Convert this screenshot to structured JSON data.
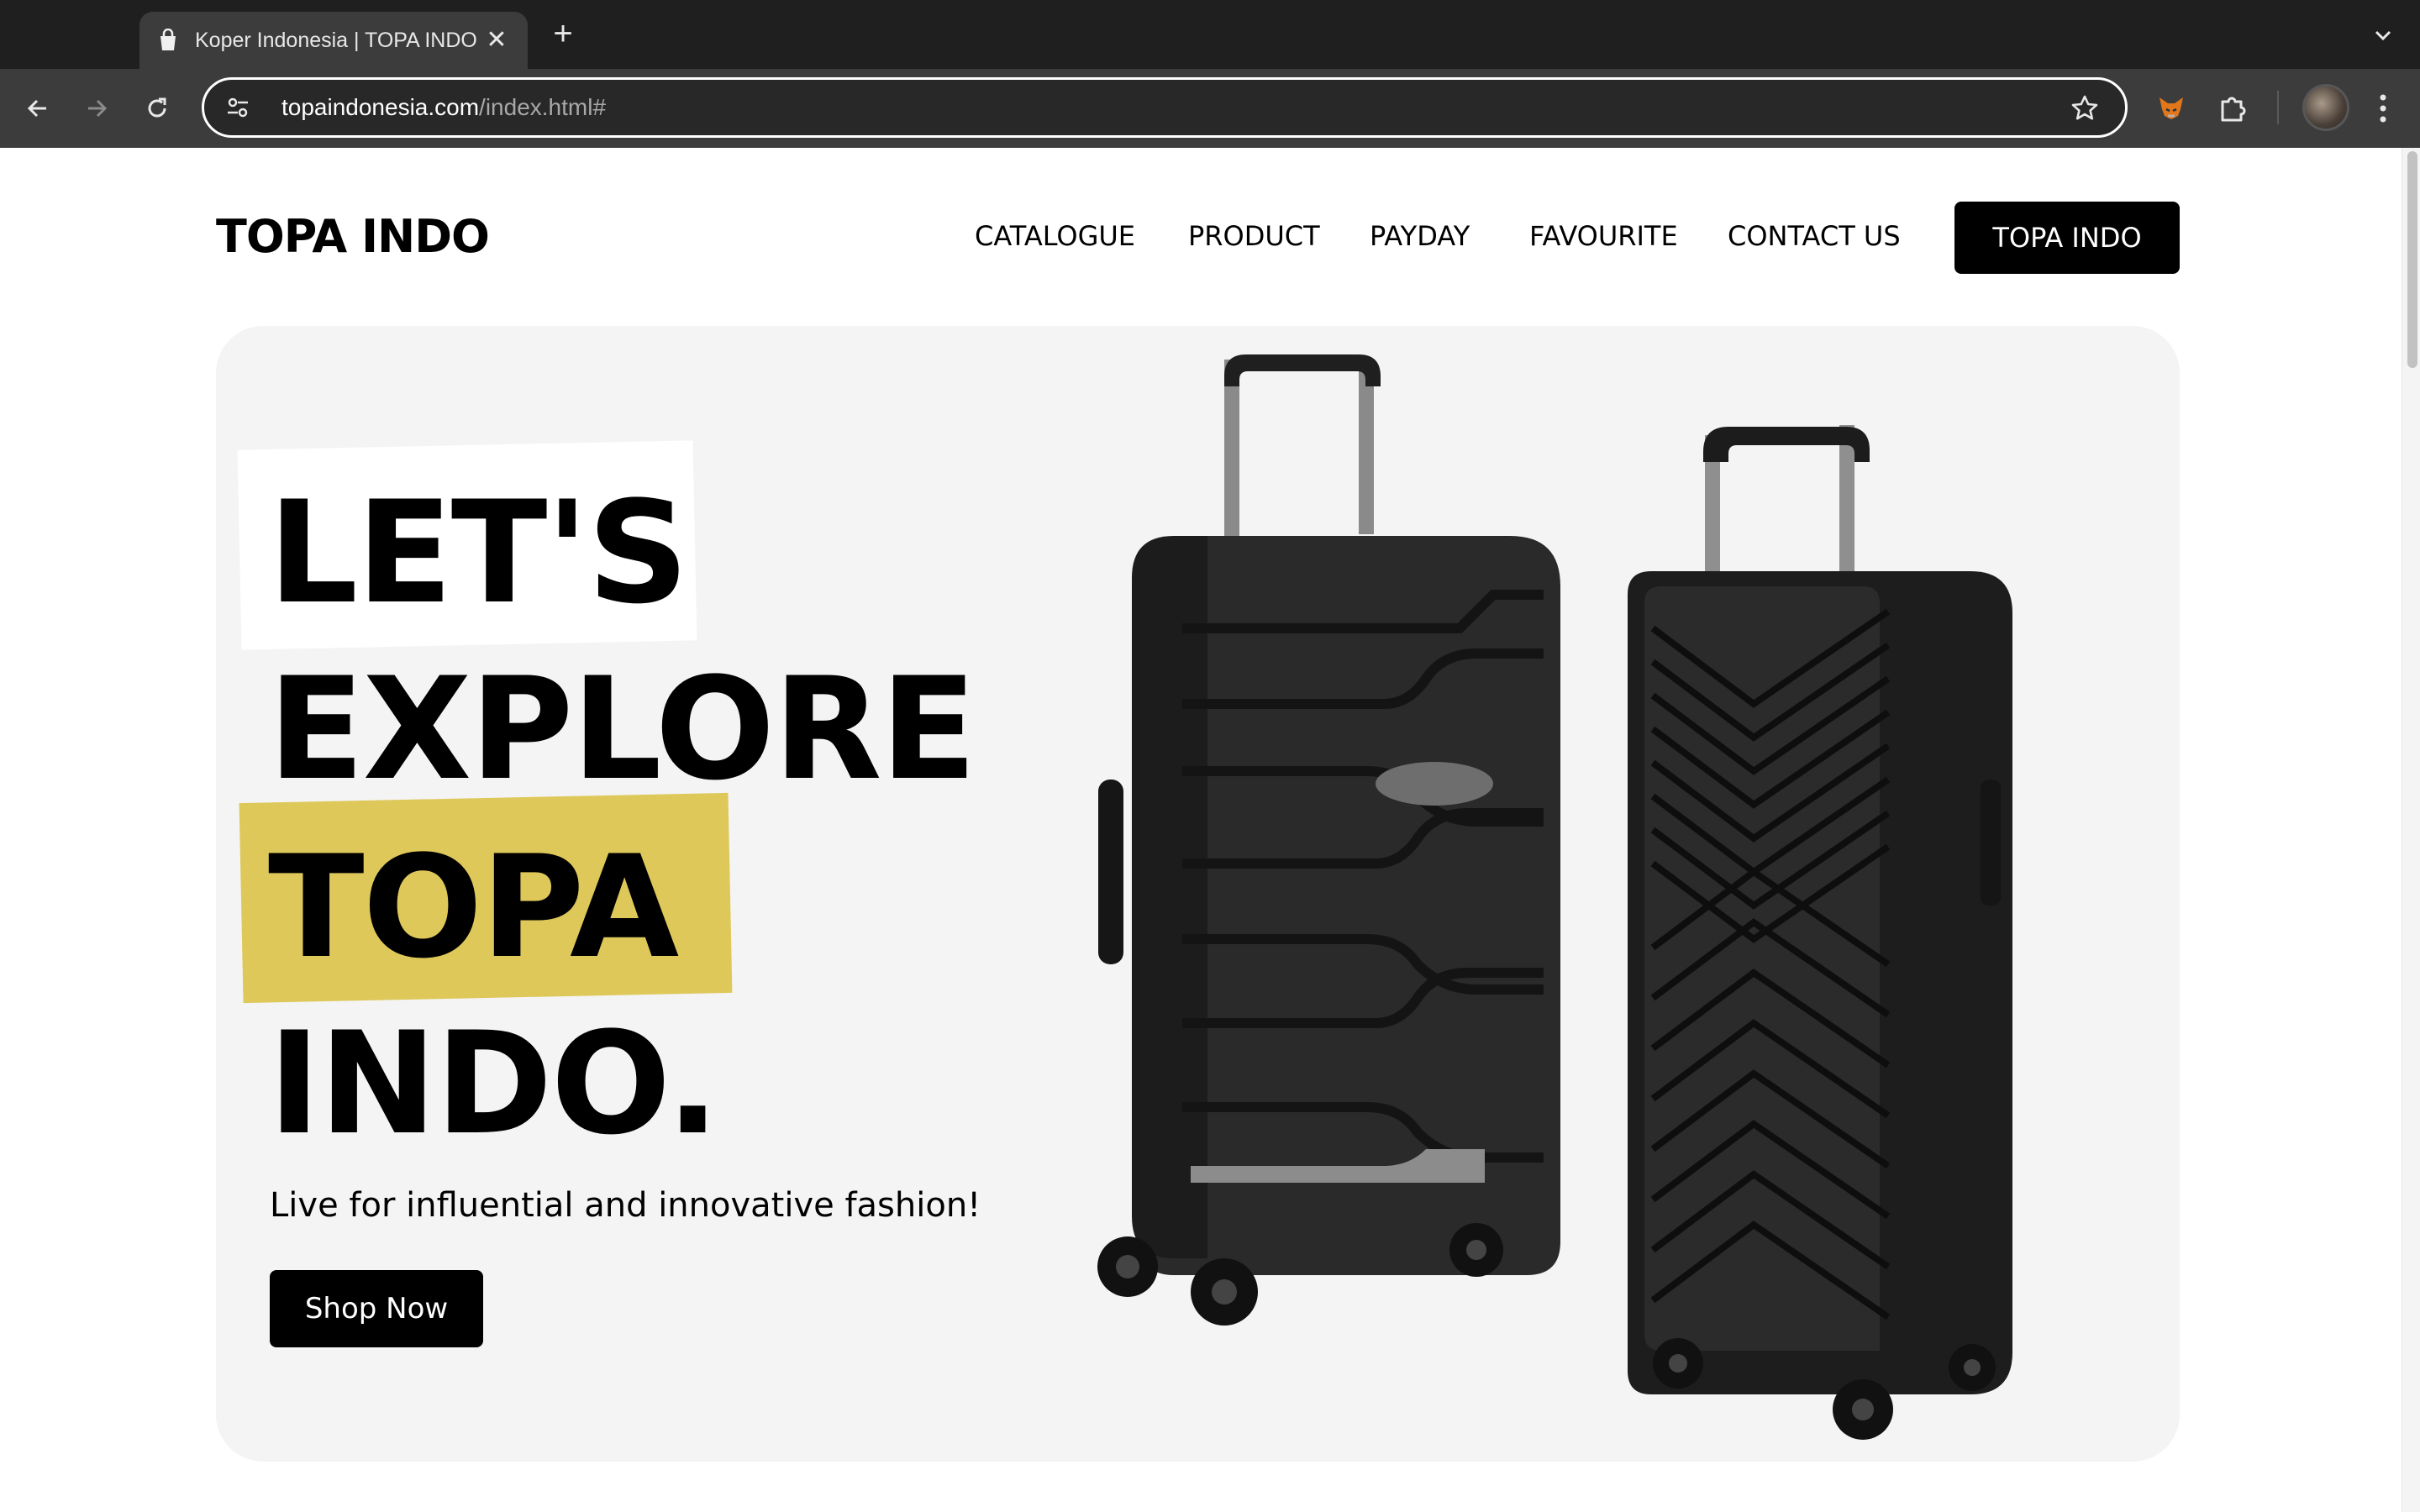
{
  "browser": {
    "tab": {
      "title": "Koper Indonesia | TOPA INDO"
    },
    "url": {
      "host": "topaindonesia.com",
      "path": "/index.html#"
    }
  },
  "site": {
    "logo": "TOPA INDO",
    "nav": {
      "links": [
        "CATALOGUE",
        "PRODUCT",
        "PAYDAY",
        "FAVOURITE",
        "CONTACT US"
      ],
      "cta": "TOPA INDO"
    },
    "hero": {
      "lines": [
        "LET'S",
        "EXPLORE",
        "TOPA",
        "INDO."
      ],
      "subtitle": "Live for influential and innovative fashion!",
      "button": "Shop Now",
      "colors": {
        "highlight": "#dfc85a",
        "background": "#f3f4f3"
      }
    }
  }
}
